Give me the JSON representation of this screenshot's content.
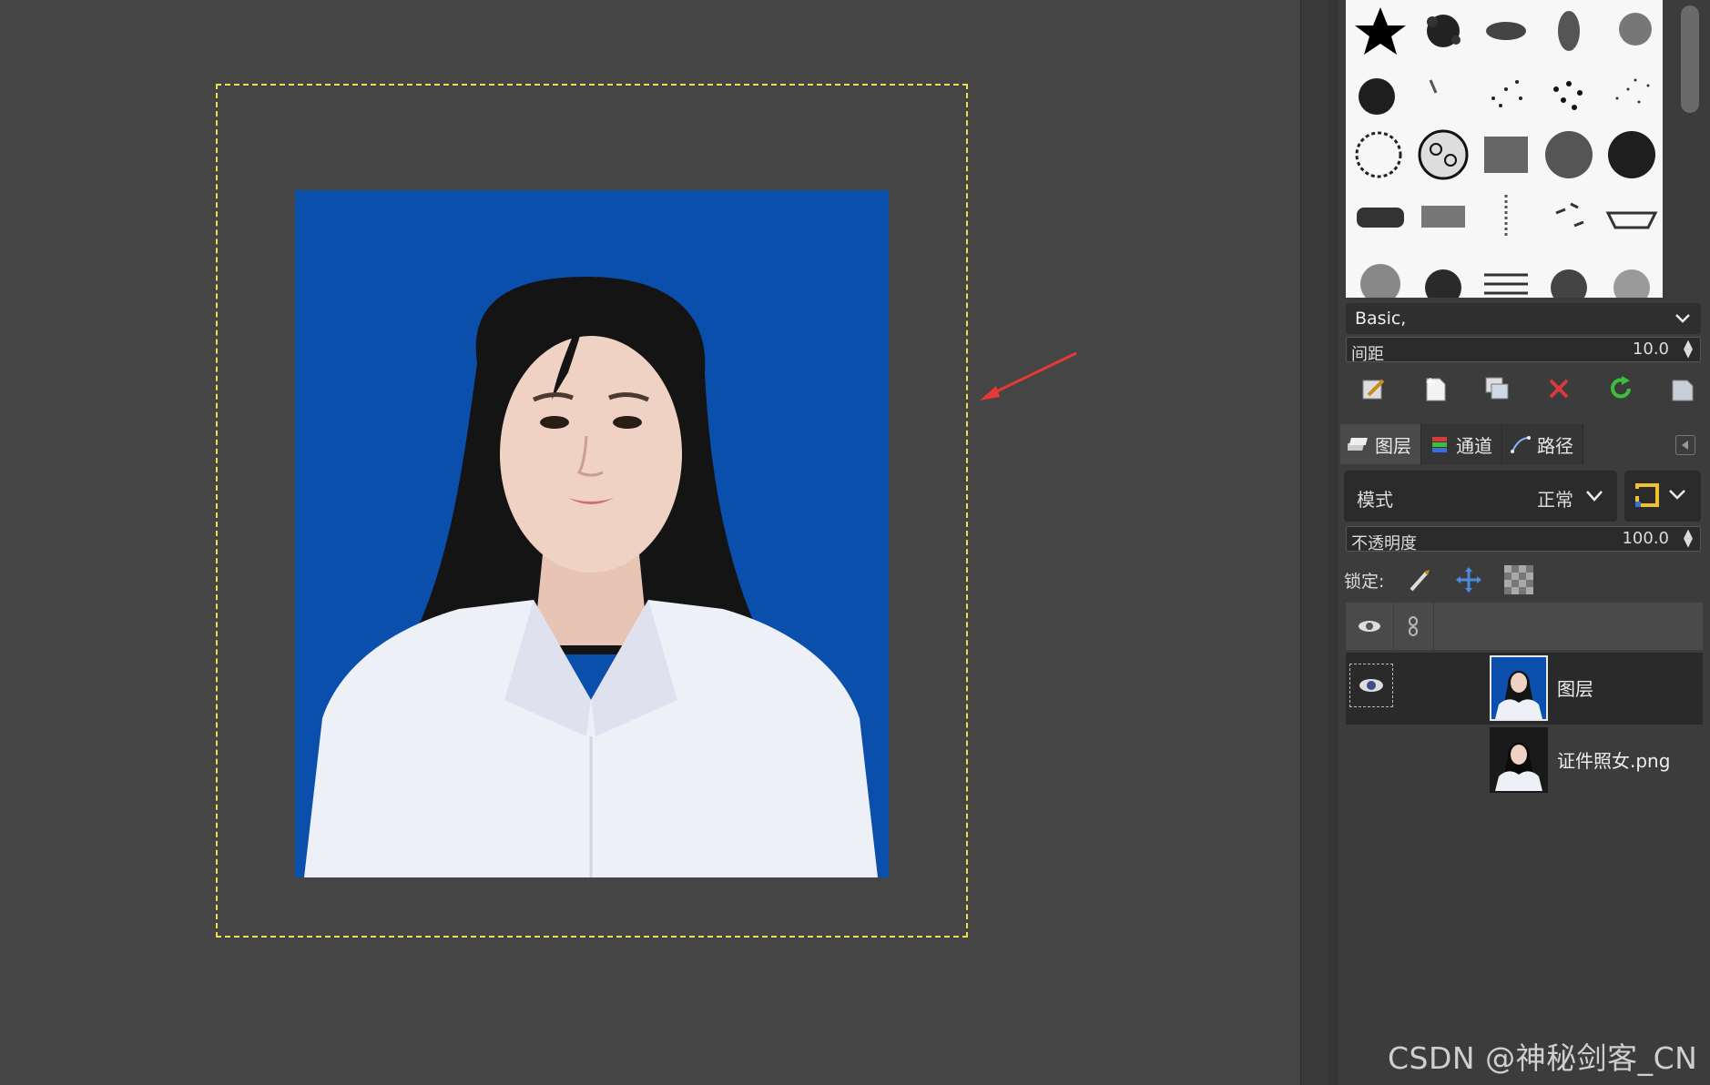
{
  "canvas": {
    "photo_description_alt": "ID photo",
    "annotation_color": "#e53935",
    "selection_color": "#e9e04a",
    "photo_background": "#0b4fad"
  },
  "brushes": {
    "preset_name": "Basic,",
    "spacing_label": "间距",
    "spacing_value": "10.0"
  },
  "brush_actions": [
    "edit-brush-icon",
    "new-brush-icon",
    "duplicate-brush-icon",
    "delete-brush-icon",
    "refresh-brushes-icon",
    "open-brush-as-image-icon"
  ],
  "tabs": [
    {
      "label": "图层",
      "icon": "layers-icon"
    },
    {
      "label": "通道",
      "icon": "channels-icon"
    },
    {
      "label": "路径",
      "icon": "paths-icon"
    }
  ],
  "layer_mode": {
    "label": "模式",
    "value": "正常"
  },
  "opacity": {
    "label": "不透明度",
    "value": "100.0"
  },
  "lock": {
    "label": "锁定:"
  },
  "layers": [
    {
      "name": "图层",
      "visible": true,
      "selected": true
    },
    {
      "name": "证件照女.png",
      "visible": false,
      "selected": false
    }
  ],
  "watermark": "CSDN @神秘剑客_CN"
}
